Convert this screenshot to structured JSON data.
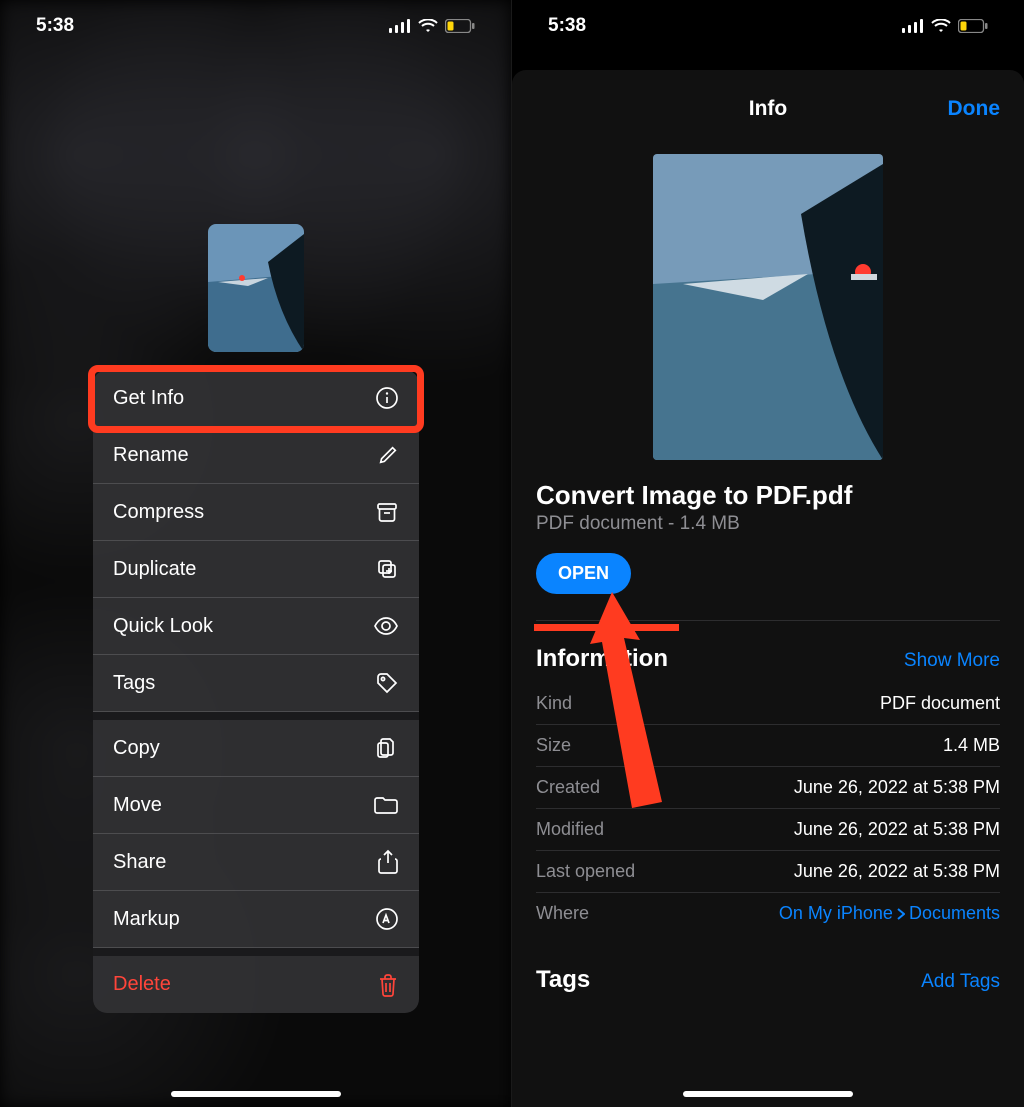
{
  "status": {
    "time": "5:38"
  },
  "context_menu": {
    "items": [
      {
        "label": "Get Info",
        "icon": "info"
      },
      {
        "label": "Rename",
        "icon": "pencil"
      },
      {
        "label": "Compress",
        "icon": "archive"
      },
      {
        "label": "Duplicate",
        "icon": "duplicate"
      },
      {
        "label": "Quick Look",
        "icon": "eye"
      },
      {
        "label": "Tags",
        "icon": "tag"
      }
    ],
    "items2": [
      {
        "label": "Copy",
        "icon": "doc-on-doc"
      },
      {
        "label": "Move",
        "icon": "folder"
      },
      {
        "label": "Share",
        "icon": "share"
      },
      {
        "label": "Markup",
        "icon": "markup"
      }
    ],
    "delete": {
      "label": "Delete",
      "icon": "trash"
    }
  },
  "info_sheet": {
    "title": "Info",
    "done": "Done",
    "file_name": "Convert Image to PDF.pdf",
    "file_sub": "PDF document - 1.4 MB",
    "open": "OPEN",
    "information_heading": "Information",
    "show_more": "Show More",
    "rows": [
      {
        "k": "Kind",
        "v": "PDF document"
      },
      {
        "k": "Size",
        "v": "1.4 MB"
      },
      {
        "k": "Created",
        "v": "June 26, 2022 at 5:38 PM"
      },
      {
        "k": "Modified",
        "v": "June 26, 2022 at 5:38 PM"
      },
      {
        "k": "Last opened",
        "v": "June 26, 2022 at 5:38 PM"
      }
    ],
    "where_label": "Where",
    "where_path": [
      "On My iPhone",
      "Documents"
    ],
    "tags_heading": "Tags",
    "add_tags": "Add Tags"
  }
}
